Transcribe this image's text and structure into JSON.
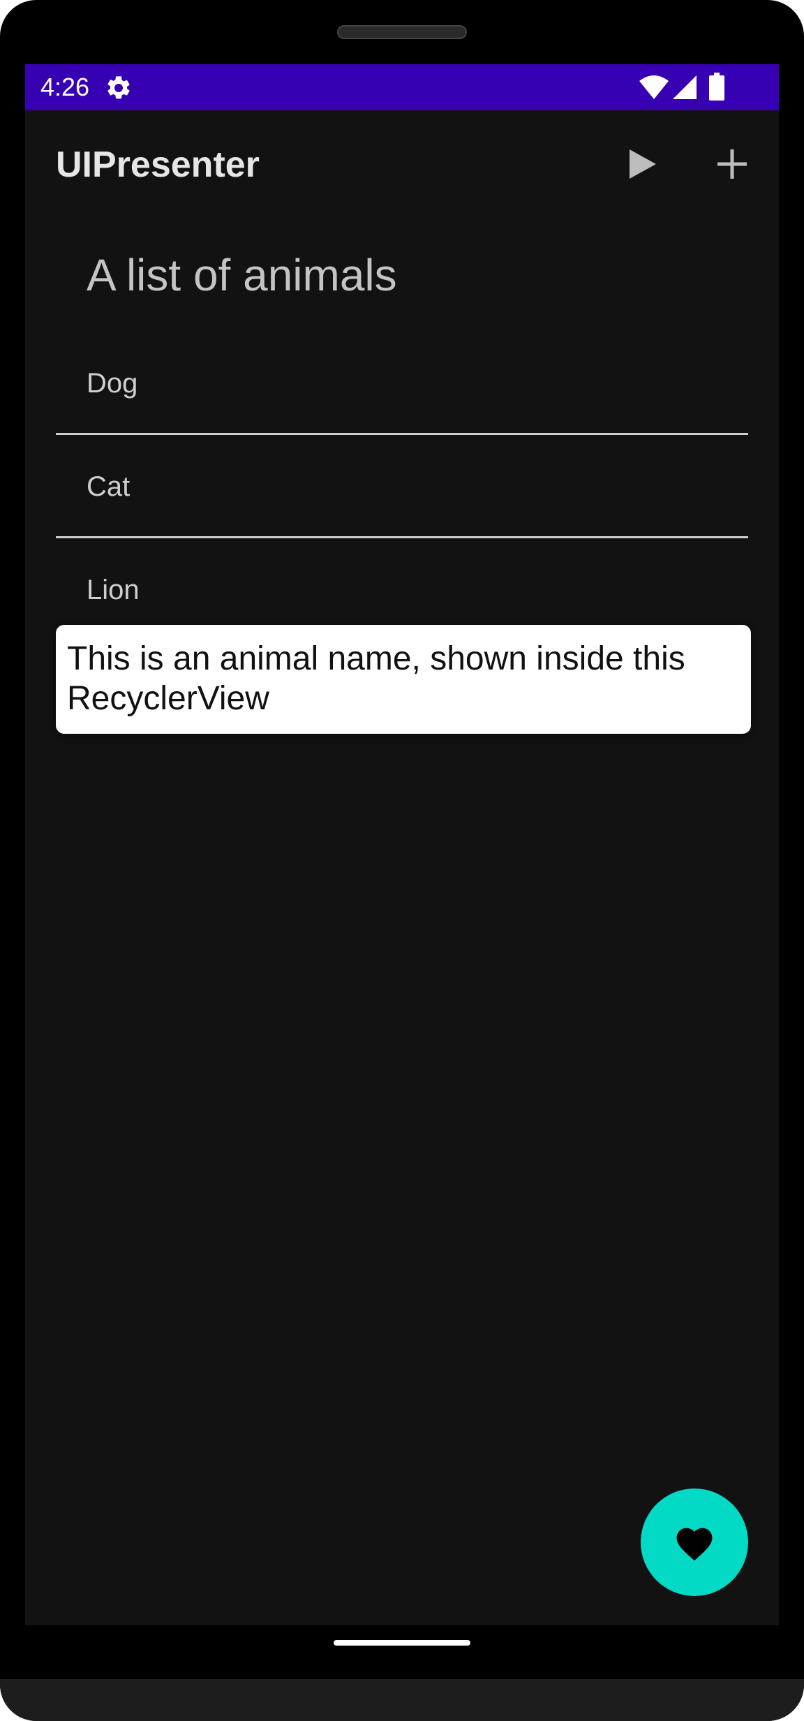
{
  "status_bar": {
    "time": "4:26",
    "background_color": "#3700b3",
    "icons": [
      "gear-icon",
      "wifi-icon",
      "cell-signal-icon",
      "battery-icon"
    ]
  },
  "app_bar": {
    "title": "UIPresenter",
    "actions": [
      "play-icon",
      "plus-icon"
    ]
  },
  "content": {
    "heading": "A list of animals",
    "animals": [
      {
        "label": "Dog"
      },
      {
        "label": "Cat"
      },
      {
        "label": "Lion"
      }
    ],
    "tooltip_text": "This is an animal name, shown inside this RecyclerView"
  },
  "fab": {
    "icon": "heart-icon",
    "color": "#03dac5"
  },
  "theme": {
    "background": "#121212",
    "accent": "#03dac5"
  }
}
